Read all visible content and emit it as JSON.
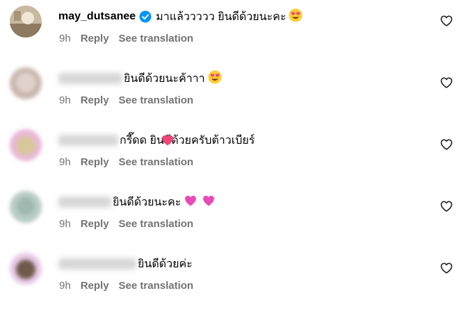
{
  "comments": [
    {
      "username": "may_dutsanee",
      "verified": true,
      "text": "มาแล้ววววว ยินดีด้วยนะคะ",
      "emoji": "heart-eyes",
      "time": "9h",
      "reply_label": "Reply",
      "translate_label": "See translation"
    },
    {
      "username": "",
      "text": "ยินดีด้วยนะค้าาา",
      "emoji": "heart-eyes",
      "time": "9h",
      "reply_label": "Reply",
      "translate_label": "See translation"
    },
    {
      "username": "",
      "text": "กรี๊ดด   ยินดีด้วยครับต้าวเบียร์",
      "emoji": "pink-heart",
      "time": "9h",
      "reply_label": "Reply",
      "translate_label": "See translation"
    },
    {
      "username": "",
      "text": "ยินดีด้วยนะคะ",
      "emoji": "pink-hearts",
      "time": "9h",
      "reply_label": "Reply",
      "translate_label": "See translation"
    },
    {
      "username": "",
      "text": "ยินดีด้วยค่ะ",
      "time": "9h",
      "reply_label": "Reply",
      "translate_label": "See translation"
    }
  ],
  "colors": {
    "meta_gray": "#737373",
    "verified_blue": "#0095f6",
    "pink_heart": "#f0457a"
  }
}
